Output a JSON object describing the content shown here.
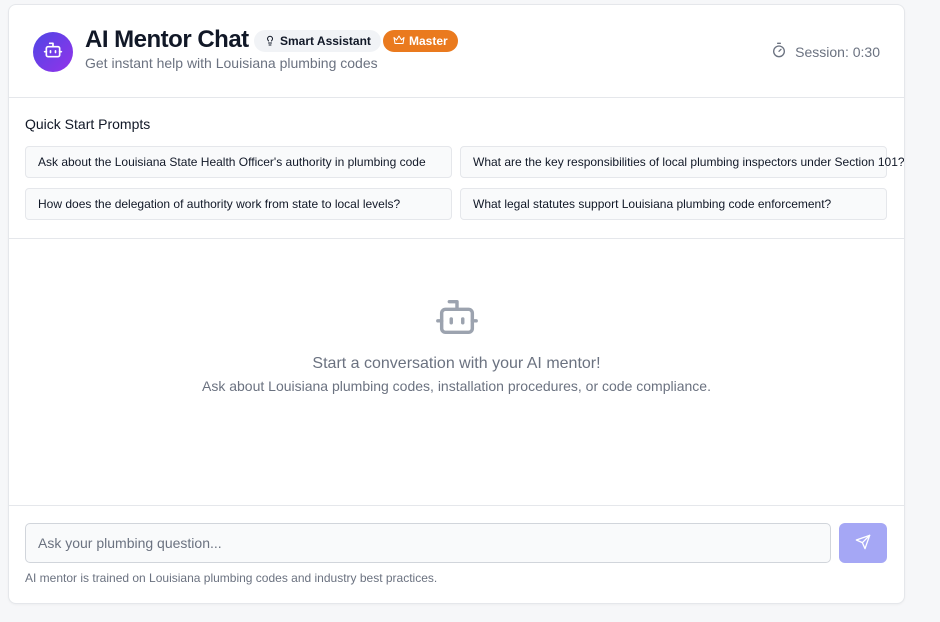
{
  "header": {
    "title": "AI Mentor Chat",
    "subtitle": "Get instant help with Louisiana plumbing codes",
    "badges": {
      "smart": "Smart Assistant",
      "master": "Master"
    },
    "session": "Session: 0:30",
    "icons": {
      "avatar": "bot-icon",
      "smart": "lightbulb-icon",
      "master": "crown-icon",
      "session": "timer-icon"
    }
  },
  "quick_start": {
    "title": "Quick Start Prompts",
    "prompts": [
      "Ask about the Louisiana State Health Officer's authority in plumbing code",
      "What are the key responsibilities of local plumbing inspectors under Section 101?",
      "How does the delegation of authority work from state to local levels?",
      "What legal statutes support Louisiana plumbing code enforcement?"
    ]
  },
  "empty_state": {
    "title": "Start a conversation with your AI mentor!",
    "subtitle": "Ask about Louisiana plumbing codes, installation procedures, or code compliance.",
    "icon": "bot-icon"
  },
  "composer": {
    "placeholder": "Ask your plumbing question...",
    "value": "",
    "send_icon": "send-icon",
    "footnote": "AI mentor is trained on Louisiana plumbing codes and industry best practices."
  },
  "colors": {
    "avatar_gradient_start": "#4f46e5",
    "avatar_gradient_end": "#9333ea",
    "master_badge": "#ea7a1e",
    "send_button": "#a5a7f5",
    "muted_text": "#6b7280"
  }
}
